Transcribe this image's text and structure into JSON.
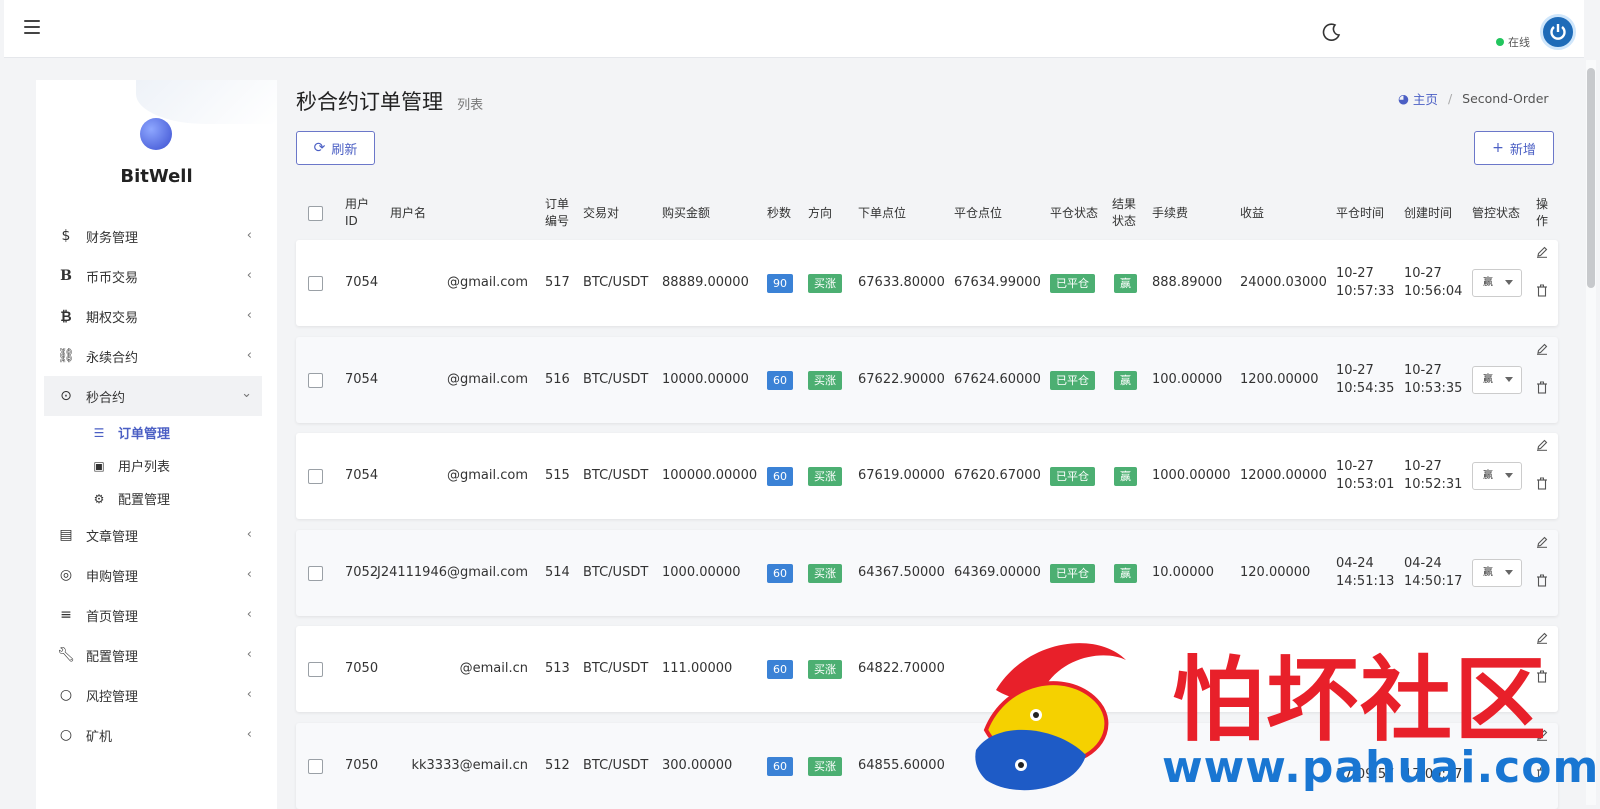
{
  "topbar": {
    "online": "在线"
  },
  "brand": {
    "name": "BitWell"
  },
  "sidebar": {
    "items": [
      {
        "label": "财务管理",
        "icon": "dollar-icon"
      },
      {
        "label": "币币交易",
        "icon": "bold-b-icon"
      },
      {
        "label": "期权交易",
        "icon": "bitcoin-icon"
      },
      {
        "label": "永续合约",
        "icon": "link-icon"
      },
      {
        "label": "秒合约",
        "icon": "dot-circle-icon",
        "active": true,
        "children": [
          {
            "label": "订单管理",
            "icon": "list-icon",
            "active": true
          },
          {
            "label": "用户列表",
            "icon": "user-card-icon"
          },
          {
            "label": "配置管理",
            "icon": "gear-icon"
          }
        ]
      },
      {
        "label": "文章管理",
        "icon": "newspaper-icon"
      },
      {
        "label": "申购管理",
        "icon": "lifebuoy-icon"
      },
      {
        "label": "首页管理",
        "icon": "bars-icon"
      },
      {
        "label": "配置管理",
        "icon": "wrench-icon"
      },
      {
        "label": "风控管理",
        "icon": "circle-icon"
      },
      {
        "label": "矿机",
        "icon": "circle-icon"
      }
    ]
  },
  "header": {
    "title": "秒合约订单管理",
    "subtitle": "列表"
  },
  "breadcrumb": {
    "home": "主页",
    "current": "Second-Order"
  },
  "toolbar": {
    "refresh": "刷新",
    "add": "新增"
  },
  "table": {
    "columns": {
      "user_id_1": "用户",
      "user_id_2": "ID",
      "username": "用户名",
      "order_no_1": "订单",
      "order_no_2": "编号",
      "pair": "交易对",
      "amount": "购买金额",
      "seconds": "秒数",
      "direction": "方向",
      "open_price": "下单点位",
      "close_price": "平仓点位",
      "close_status": "平仓状态",
      "result_1": "结果",
      "result_2": "状态",
      "fee": "手续费",
      "profit": "收益",
      "close_time": "平仓时间",
      "create_time": "创建时间",
      "control": "管控状态",
      "action_1": "操",
      "action_2": "作"
    },
    "rows": [
      {
        "user_id": "7054",
        "username": "@gmail.com",
        "order_no": "517",
        "pair": "BTC/USDT",
        "amount": "88889.00000",
        "seconds": "90",
        "direction": "买涨",
        "open_price": "67633.80000",
        "close_price": "67634.99000",
        "close_status": "已平仓",
        "result": "赢",
        "fee": "888.89000",
        "profit": "24000.03000",
        "close_date": "10-27",
        "close_clock": "10:57:33",
        "create_date": "10-27",
        "create_clock": "10:56:04",
        "control": "赢"
      },
      {
        "user_id": "7054",
        "username": "@gmail.com",
        "order_no": "516",
        "pair": "BTC/USDT",
        "amount": "10000.00000",
        "seconds": "60",
        "direction": "买涨",
        "open_price": "67622.90000",
        "close_price": "67624.60000",
        "close_status": "已平仓",
        "result": "赢",
        "fee": "100.00000",
        "profit": "1200.00000",
        "close_date": "10-27",
        "close_clock": "10:54:35",
        "create_date": "10-27",
        "create_clock": "10:53:35",
        "control": "赢"
      },
      {
        "user_id": "7054",
        "username": "@gmail.com",
        "order_no": "515",
        "pair": "BTC/USDT",
        "amount": "100000.00000",
        "seconds": "60",
        "direction": "买涨",
        "open_price": "67619.00000",
        "close_price": "67620.67000",
        "close_status": "已平仓",
        "result": "赢",
        "fee": "1000.00000",
        "profit": "12000.00000",
        "close_date": "10-27",
        "close_clock": "10:53:01",
        "create_date": "10-27",
        "create_clock": "10:52:31",
        "control": "赢"
      },
      {
        "user_id": "7052",
        "username": "J24111946@gmail.com",
        "order_no": "514",
        "pair": "BTC/USDT",
        "amount": "1000.00000",
        "seconds": "60",
        "direction": "买涨",
        "open_price": "64367.50000",
        "close_price": "64369.00000",
        "close_status": "已平仓",
        "result": "赢",
        "fee": "10.00000",
        "profit": "120.00000",
        "close_date": "04-24",
        "close_clock": "14:51:13",
        "create_date": "04-24",
        "create_clock": "14:50:17",
        "control": "赢"
      },
      {
        "user_id": "7050",
        "username": "@email.cn",
        "order_no": "513",
        "pair": "BTC/USDT",
        "amount": "111.00000",
        "seconds": "60",
        "direction": "买涨",
        "open_price": "64822.70000",
        "close_price": "",
        "close_status": "",
        "result": "",
        "fee": "",
        "profit": "",
        "close_date": "",
        "close_clock": "",
        "create_date": "",
        "create_clock": "",
        "control": ""
      },
      {
        "user_id": "7050",
        "username": "kk3333@email.cn",
        "order_no": "512",
        "pair": "BTC/USDT",
        "amount": "300.00000",
        "seconds": "60",
        "direction": "买涨",
        "open_price": "64855.60000",
        "close_price": "",
        "close_status": "",
        "result": "",
        "fee": "",
        "profit": "",
        "close_date": "",
        "close_clock": "17:09:57",
        "create_date": "",
        "create_clock": "17:09:27",
        "control": ""
      }
    ]
  },
  "watermark": {
    "title": "怕坏社区",
    "url": "www.pahuai.com"
  },
  "colors": {
    "accent": "#4b5fc4",
    "seconds_badge": "#3b82d6",
    "success": "#4caf72",
    "loss": "#e05b5b",
    "online": "#22c55e"
  }
}
